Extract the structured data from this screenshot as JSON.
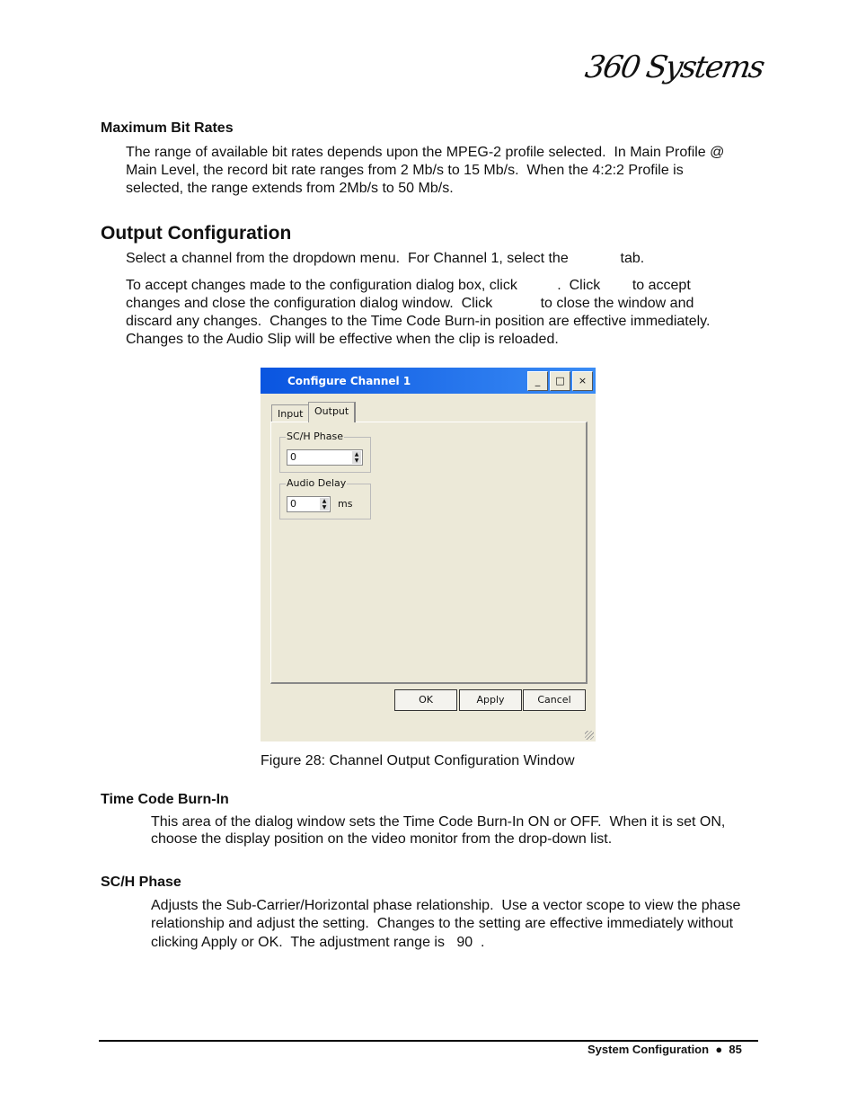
{
  "logo": "360 Systems",
  "sections": {
    "max_bit_rates": {
      "heading": "Maximum Bit Rates",
      "lines": [
        "The range of available bit rates depends upon the MPEG-2 profile selected.  In Main Profile @",
        "Main Level, the record bit rate ranges from 2 Mb/s to 15 Mb/s.  When the 4:2:2 Profile is",
        "selected, the range extends from 2Mb/s to 50 Mb/s."
      ]
    },
    "output_config": {
      "heading": "Output Configuration",
      "p1": "Select a channel from the dropdown menu.  For Channel 1, select the             tab.",
      "p2": [
        "To accept changes made to the configuration dialog box, click          .  Click        to accept",
        "changes and close the configuration dialog window.  Click            to close the window and",
        "discard any changes.  Changes to the Time Code Burn-in position are effective immediately.",
        "Changes to the Audio Slip will be effective when the clip is reloaded."
      ]
    },
    "time_code": {
      "heading": "Time Code Burn-In",
      "lines": [
        "This area of the dialog window sets the Time Code Burn-In ON or OFF.  When it is set ON,",
        "choose the display position on the video monitor from the drop-down list."
      ]
    },
    "sch_phase": {
      "heading": "SC/H Phase",
      "lines": [
        "Adjusts the Sub-Carrier/Horizontal phase relationship.  Use a vector scope to view the phase",
        "relationship and adjust the setting.  Changes to the setting are effective immediately without",
        "clicking Apply or OK.  The adjustment range is   90  ."
      ]
    }
  },
  "dialog": {
    "title": "Configure Channel 1",
    "minimize": "_",
    "maximize": "□",
    "close": "×",
    "tabs": [
      "Input",
      "Output"
    ],
    "active_tab": "Output",
    "sch_label": "SC/H Phase",
    "sch_value": "0",
    "audio_label": "Audio Delay",
    "audio_value": "0",
    "audio_unit": "ms",
    "ok": "OK",
    "apply": "Apply",
    "cancel": "Cancel"
  },
  "caption": "Figure 28: Channel Output Configuration Window",
  "footer": {
    "section": "System Configuration",
    "bullet": "●",
    "page": "85"
  }
}
